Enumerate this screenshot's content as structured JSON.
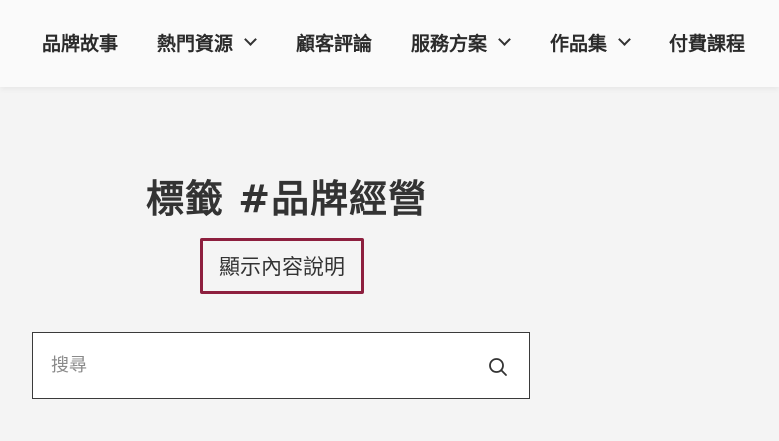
{
  "nav": {
    "items": [
      {
        "label": "品牌故事",
        "has_dropdown": false
      },
      {
        "label": "熱門資源",
        "has_dropdown": true
      },
      {
        "label": "顧客評論",
        "has_dropdown": false
      },
      {
        "label": "服務方案",
        "has_dropdown": true
      },
      {
        "label": "作品集",
        "has_dropdown": true
      },
      {
        "label": "付費課程",
        "has_dropdown": false
      }
    ]
  },
  "main": {
    "title": "標籤 #品牌經營",
    "description_label": "顯示內容說明",
    "accent_color": "#8d1f3e"
  },
  "search": {
    "placeholder": "搜尋",
    "value": "",
    "icon": "search-icon"
  }
}
